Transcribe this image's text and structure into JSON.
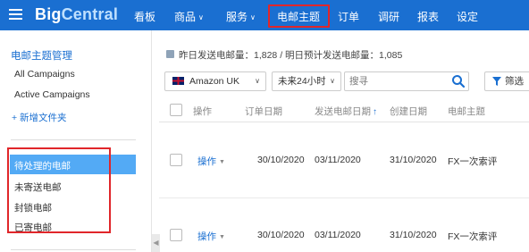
{
  "brand": {
    "name_part1": "Big",
    "name_part2": "Central"
  },
  "nav": {
    "items": [
      {
        "label": "看板",
        "has_dropdown": false
      },
      {
        "label": "商品",
        "has_dropdown": true
      },
      {
        "label": "服务",
        "has_dropdown": true
      },
      {
        "label": "电邮主题",
        "has_dropdown": false,
        "active": true
      },
      {
        "label": "订单",
        "has_dropdown": false
      },
      {
        "label": "调研",
        "has_dropdown": false
      },
      {
        "label": "报表",
        "has_dropdown": false
      },
      {
        "label": "设定",
        "has_dropdown": false
      }
    ],
    "dropdown_caret": "∨"
  },
  "sidebar": {
    "title": "电邮主题管理",
    "links": [
      "All Campaigns",
      "Active Campaigns"
    ],
    "add_folder": "+ 新增文件夹",
    "folders": [
      "待处理的电邮",
      "未寄送电邮",
      "封锁电邮",
      "已寄电邮"
    ],
    "active_folder": "待处理的电邮",
    "collapse_glyph": "◀"
  },
  "main": {
    "stats_text": "昨日发送电邮量：1,828 / 明日预计发送电邮量：1,085",
    "marketplace": {
      "value": "Amazon UK",
      "caret": "∨"
    },
    "time_range": {
      "value": "未来24小时",
      "caret": "∨"
    },
    "search": {
      "placeholder": "搜寻"
    },
    "filter_label": "筛选",
    "table": {
      "headers": [
        "操作",
        "订单日期",
        "发送电邮日期",
        "创建日期",
        "电邮主题"
      ],
      "sort_arrow": "↑",
      "rows": [
        {
          "action": "操作",
          "order_date": "30/10/2020",
          "send_date": "03/11/2020",
          "created_date": "31/10/2020",
          "subject": "FX一次索评"
        },
        {
          "action": "操作",
          "order_date": "30/10/2020",
          "send_date": "03/11/2020",
          "created_date": "31/10/2020",
          "subject": "FX一次索评"
        }
      ]
    }
  },
  "colors": {
    "nav_bg": "#1a6fd1",
    "accent": "#1a6fd1",
    "active_folder_bg": "#53aaf5",
    "highlight_box": "#e0262a"
  }
}
